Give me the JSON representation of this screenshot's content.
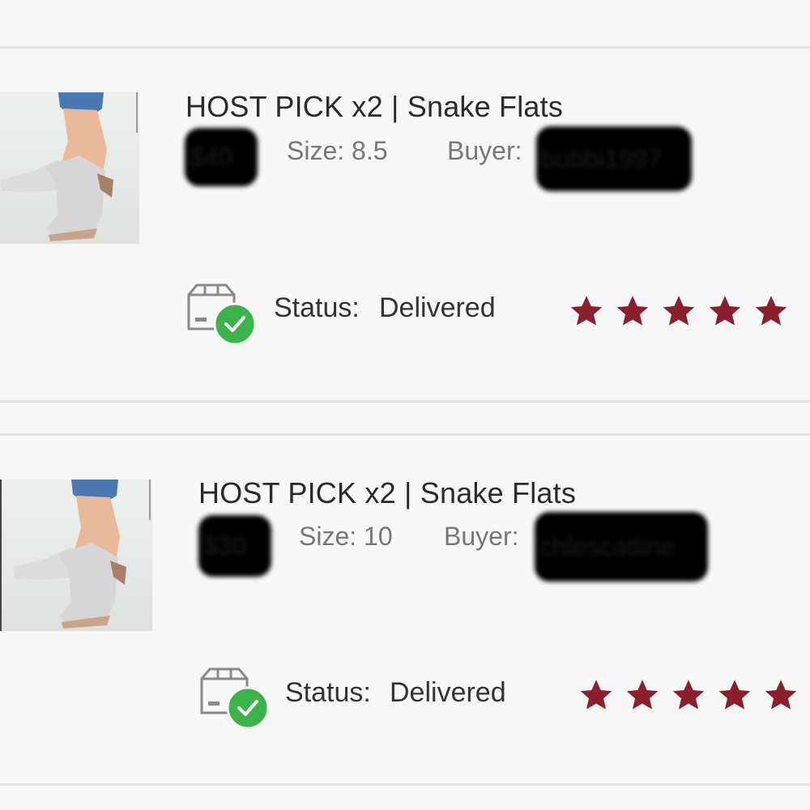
{
  "orders": [
    {
      "title": "HOST PICK x2 | Snake Flats",
      "price": "$40",
      "size_label": "Size: 8.5",
      "buyer_label": "Buyer:",
      "buyer_name": "bubbi1997",
      "status_label": "Status:",
      "status_value": "Delivered",
      "rating": 5
    },
    {
      "title": "HOST PICK x2 | Snake Flats",
      "price": "$30",
      "size_label": "Size: 10",
      "buyer_label": "Buyer:",
      "buyer_name": "chlescatline",
      "status_label": "Status:",
      "status_value": "Delivered",
      "rating": 5
    }
  ],
  "colors": {
    "star": "#8b1f2e",
    "check": "#3cb34a",
    "divider": "#e3e1e3",
    "background": "#f8f7f8"
  },
  "icons": {
    "thumbnail": "sandal-photo",
    "status": "package-delivered-icon",
    "rating": "star-icon"
  }
}
